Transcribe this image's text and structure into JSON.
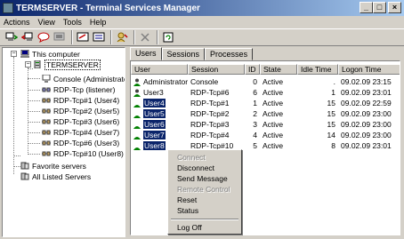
{
  "window": {
    "title": "TERMSERVER - Terminal Services Manager",
    "min": "_",
    "max": "□",
    "close": "×"
  },
  "menu": [
    "Actions",
    "View",
    "Tools",
    "Help"
  ],
  "tree": {
    "root": "This computer",
    "server": "TERMSERVER",
    "sessions": [
      "Console (Administrator)",
      "RDP-Tcp (listener)",
      "RDP-Tcp#1 (User4)",
      "RDP-Tcp#2 (User5)",
      "RDP-Tcp#3 (User6)",
      "RDP-Tcp#4 (User7)",
      "RDP-Tcp#6 (User3)",
      "RDP-Tcp#10 (User8)"
    ],
    "favorites": "Favorite servers",
    "all": "All Listed Servers"
  },
  "tabs": [
    "Users",
    "Sessions",
    "Processes"
  ],
  "columns": [
    "User",
    "Session",
    "ID",
    "State",
    "Idle Time",
    "Logon Time"
  ],
  "rows": [
    {
      "user": "Administrator",
      "session": "Console",
      "id": "0",
      "state": "Active",
      "idle": ".",
      "logon": "09.02.09 23:15",
      "selected": false
    },
    {
      "user": "User3",
      "session": "RDP-Tcp#6",
      "id": "6",
      "state": "Active",
      "idle": "1",
      "logon": "09.02.09 23:01",
      "selected": false
    },
    {
      "user": "User4",
      "session": "RDP-Tcp#1",
      "id": "1",
      "state": "Active",
      "idle": "15",
      "logon": "09.02.09 22:59",
      "selected": true
    },
    {
      "user": "User5",
      "session": "RDP-Tcp#2",
      "id": "2",
      "state": "Active",
      "idle": "15",
      "logon": "09.02.09 23:00",
      "selected": true
    },
    {
      "user": "User6",
      "session": "RDP-Tcp#3",
      "id": "3",
      "state": "Active",
      "idle": "15",
      "logon": "09.02.09 23:00",
      "selected": true
    },
    {
      "user": "User7",
      "session": "RDP-Tcp#4",
      "id": "4",
      "state": "Active",
      "idle": "14",
      "logon": "09.02.09 23:00",
      "selected": true
    },
    {
      "user": "User8",
      "session": "RDP-Tcp#10",
      "id": "5",
      "state": "Active",
      "idle": "8",
      "logon": "09.02.09 23:01",
      "selected": true
    }
  ],
  "context_menu": [
    {
      "label": "Connect",
      "disabled": true
    },
    {
      "label": "Disconnect",
      "disabled": false
    },
    {
      "label": "Send Message",
      "disabled": false
    },
    {
      "label": "Remote Control",
      "disabled": true
    },
    {
      "label": "Reset",
      "disabled": false
    },
    {
      "label": "Status",
      "disabled": false
    },
    {
      "label": "Log Off",
      "disabled": false
    }
  ]
}
